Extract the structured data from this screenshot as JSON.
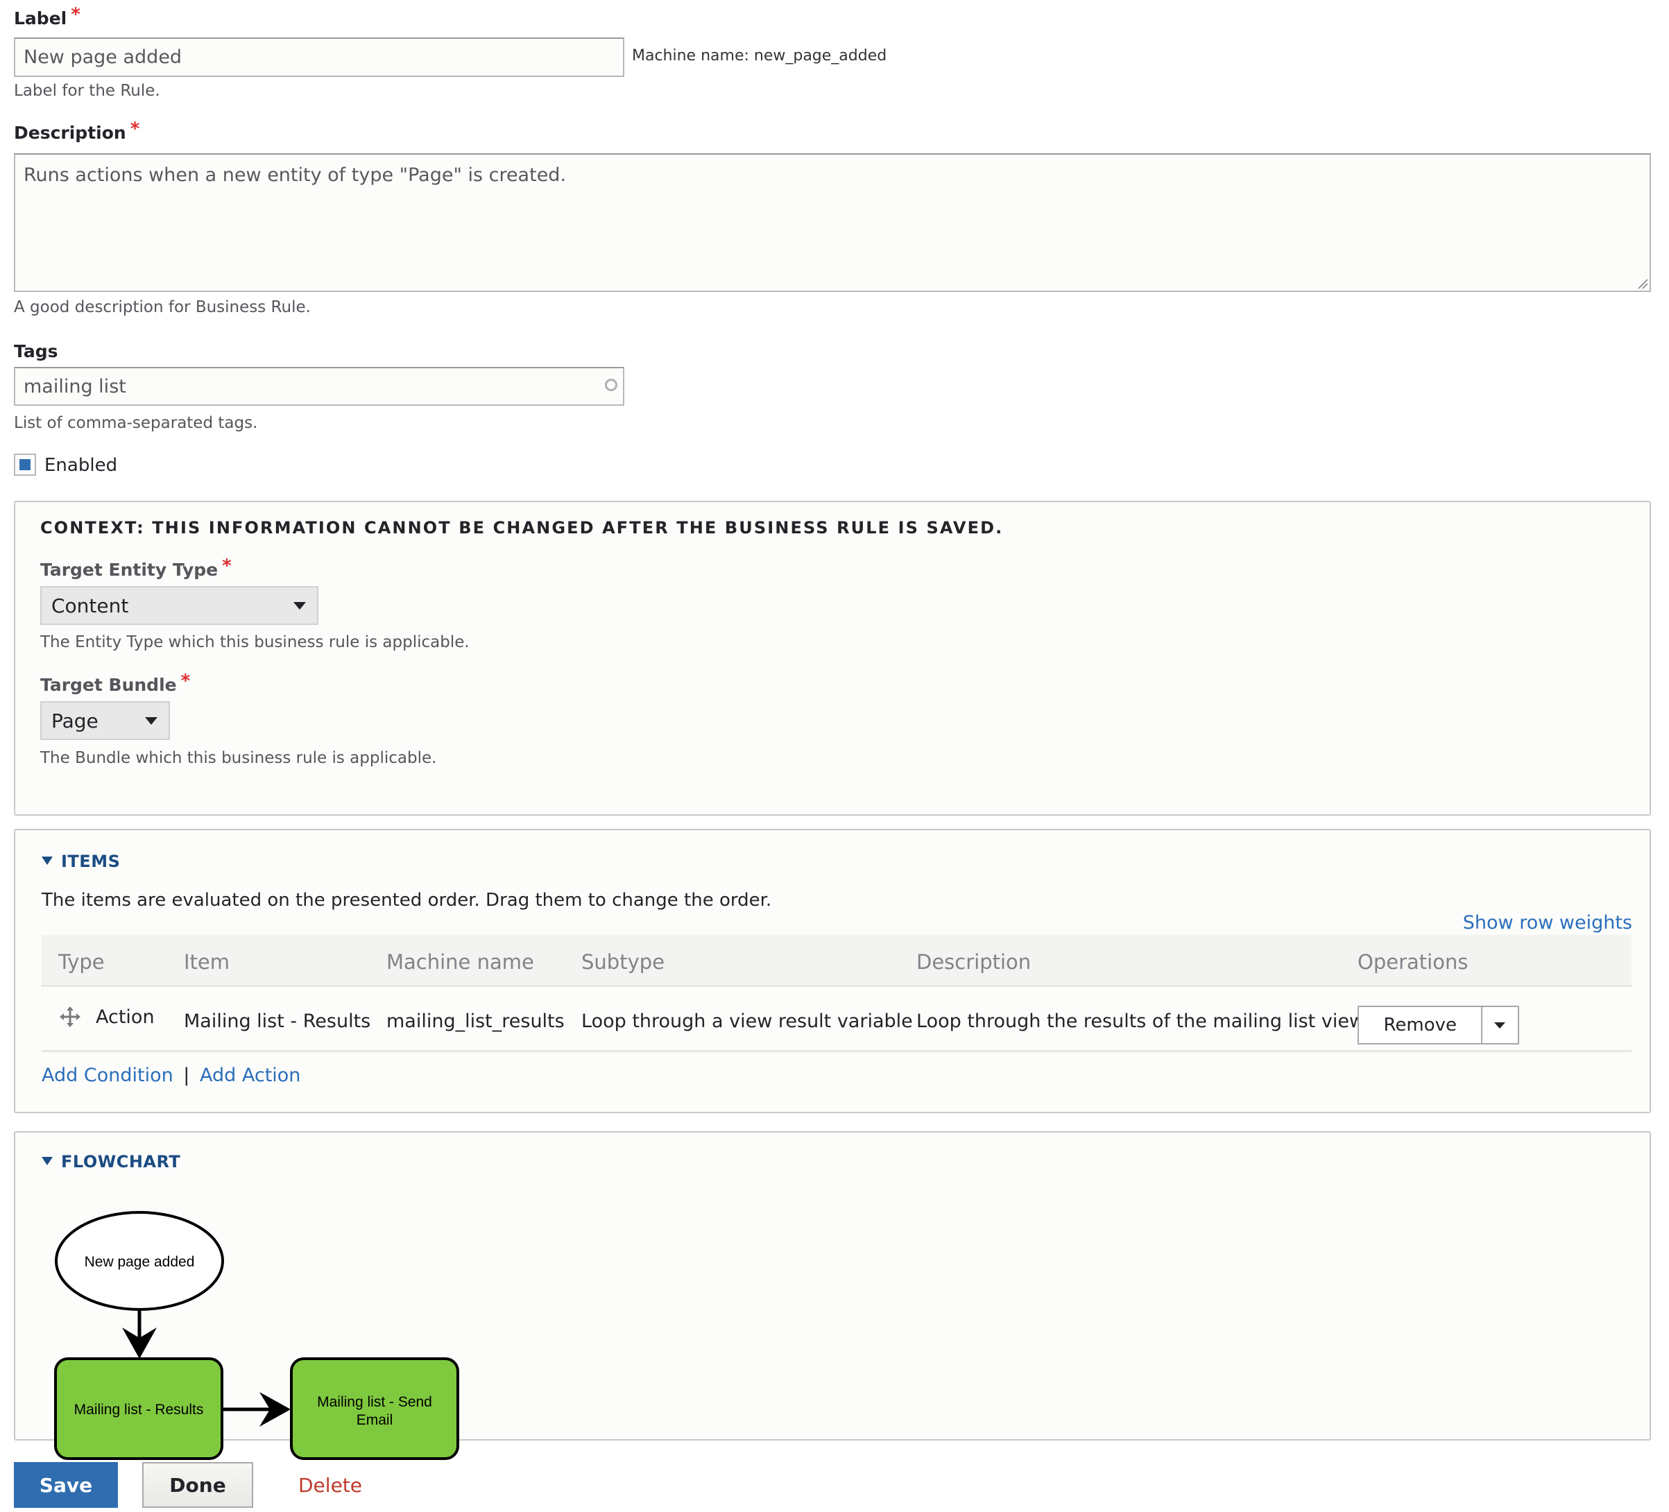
{
  "form": {
    "label": {
      "title": "Label",
      "required": "*",
      "value": "New page added",
      "machine_name": "Machine name: new_page_added",
      "help": "Label for the Rule."
    },
    "description": {
      "title": "Description",
      "required": "*",
      "value": "Runs actions when a new entity of type \"Page\" is created.",
      "help": "A good description for Business Rule."
    },
    "tags": {
      "title": "Tags",
      "value": "mailing list",
      "help": "List of comma-separated tags."
    },
    "enabled": {
      "label": "Enabled",
      "checked": true
    }
  },
  "context": {
    "heading": "CONTEXT: THIS INFORMATION CANNOT BE CHANGED AFTER THE BUSINESS RULE IS SAVED.",
    "entity_type": {
      "title": "Target Entity Type",
      "required": "*",
      "selected": "Content",
      "help": "The Entity Type which this business rule is applicable."
    },
    "bundle": {
      "title": "Target Bundle",
      "required": "*",
      "selected": "Page",
      "help": "The Bundle which this business rule is applicable."
    }
  },
  "items": {
    "summary": "ITEMS",
    "intro": "The items are evaluated on the presented order. Drag them to change the order.",
    "show_row_weights": "Show row weights",
    "columns": [
      "Type",
      "Item",
      "Machine name",
      "Subtype",
      "Description",
      "Operations"
    ],
    "rows": [
      {
        "type": "Action",
        "item": "Mailing list - Results",
        "machine_name": "mailing_list_results",
        "subtype": "Loop through a view result variable",
        "description": "Loop through the results of the mailing list view",
        "operation": "Remove"
      }
    ],
    "add_condition": "Add Condition",
    "separator": "|",
    "add_action": "Add Action"
  },
  "flowchart": {
    "summary": "FLOWCHART",
    "nodes": [
      {
        "id": "start",
        "shape": "ellipse",
        "label": "New page added",
        "fill": "#ffffff"
      },
      {
        "id": "results",
        "shape": "rounded-rect",
        "label": "Mailing list - Results",
        "fill": "#7fc93f"
      },
      {
        "id": "send",
        "shape": "rounded-rect",
        "label_line1": "Mailing list - Send",
        "label_line2": "Email",
        "fill": "#7fc93f"
      }
    ],
    "edges": [
      {
        "from": "start",
        "to": "results"
      },
      {
        "from": "results",
        "to": "send"
      }
    ]
  },
  "actions": {
    "save": "Save",
    "done": "Done",
    "delete": "Delete"
  },
  "colors": {
    "primary": "#2f6db0",
    "link": "#2a6ebb",
    "danger": "#c0392b",
    "required": "#e02e2e",
    "summary": "#1b4c83",
    "node_green": "#7fc93f"
  }
}
